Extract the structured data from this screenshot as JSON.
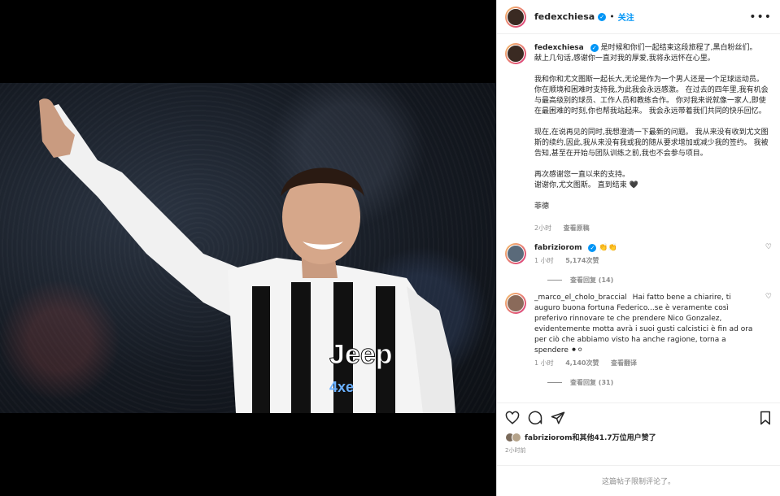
{
  "post": {
    "author": "fedexchiesa",
    "follow_label": "关注",
    "dot": "•",
    "more_label": "•••"
  },
  "caption": {
    "author": "fedexchiesa",
    "paragraphs": [
      "是时候和你们一起结束这段旅程了,黑白粉丝们。\n献上几句话,感谢你一直对我的厚爱,我将永远怀在心里。",
      "我和你和尤文图斯一起长大,无论是作为一个男人还是一个足球运动员。 你在顺境和困难时支持我,为此我会永远感激。 在过去的四年里,我有机会与最高级别的球员、工作人员和教练合作。 你对我来说就像一家人,即使在最困难的时刻,你也帮我站起来。 我会永远带着我们共同的快乐回忆。",
      "现在,在说再见的同时,我想澄清一下最新的问题。 我从来没有收到尤文图斯的续约,因此,我从来没有我或我的随从要求增加或减少我的签约。 我被告知,甚至在开始与团队训练之前,我也不会参与项目。",
      "再次感谢您一直以来的支持。\n谢谢你,尤文图斯。 直到结束 🖤",
      "菲德"
    ],
    "time": "2小时",
    "translate": "查看原稿"
  },
  "comments": [
    {
      "user": "fabriziorom",
      "verified": true,
      "text": "👏👏",
      "time": "1 小时",
      "likes": "5,174次赞",
      "replies": "查看回复 (14)"
    },
    {
      "user": "_marco_el_cholo_braccial",
      "verified": false,
      "text": "Hai fatto bene a chiarire, ti auguro buona fortuna Federico...se è veramente così preferivo rinnovare te che prendere Nico Gonzalez, evidentemente motta avrà i suoi gusti calcistici è fin ad ora per ciò che abbiamo visto ha anche ragione, torna a spendere ⚫⚪",
      "time": "1 小时",
      "likes": "4,140次赞",
      "translate": "查看翻译",
      "replies": "查看回复 (31)"
    }
  ],
  "likes_line": "fabriziorom和其他41.7万位用户赞了",
  "post_time": "2小时前",
  "footer": "这篇帖子限制评论了。",
  "colors": {
    "link": "#0095f6",
    "muted": "#8e8e8e",
    "text": "#262626"
  }
}
